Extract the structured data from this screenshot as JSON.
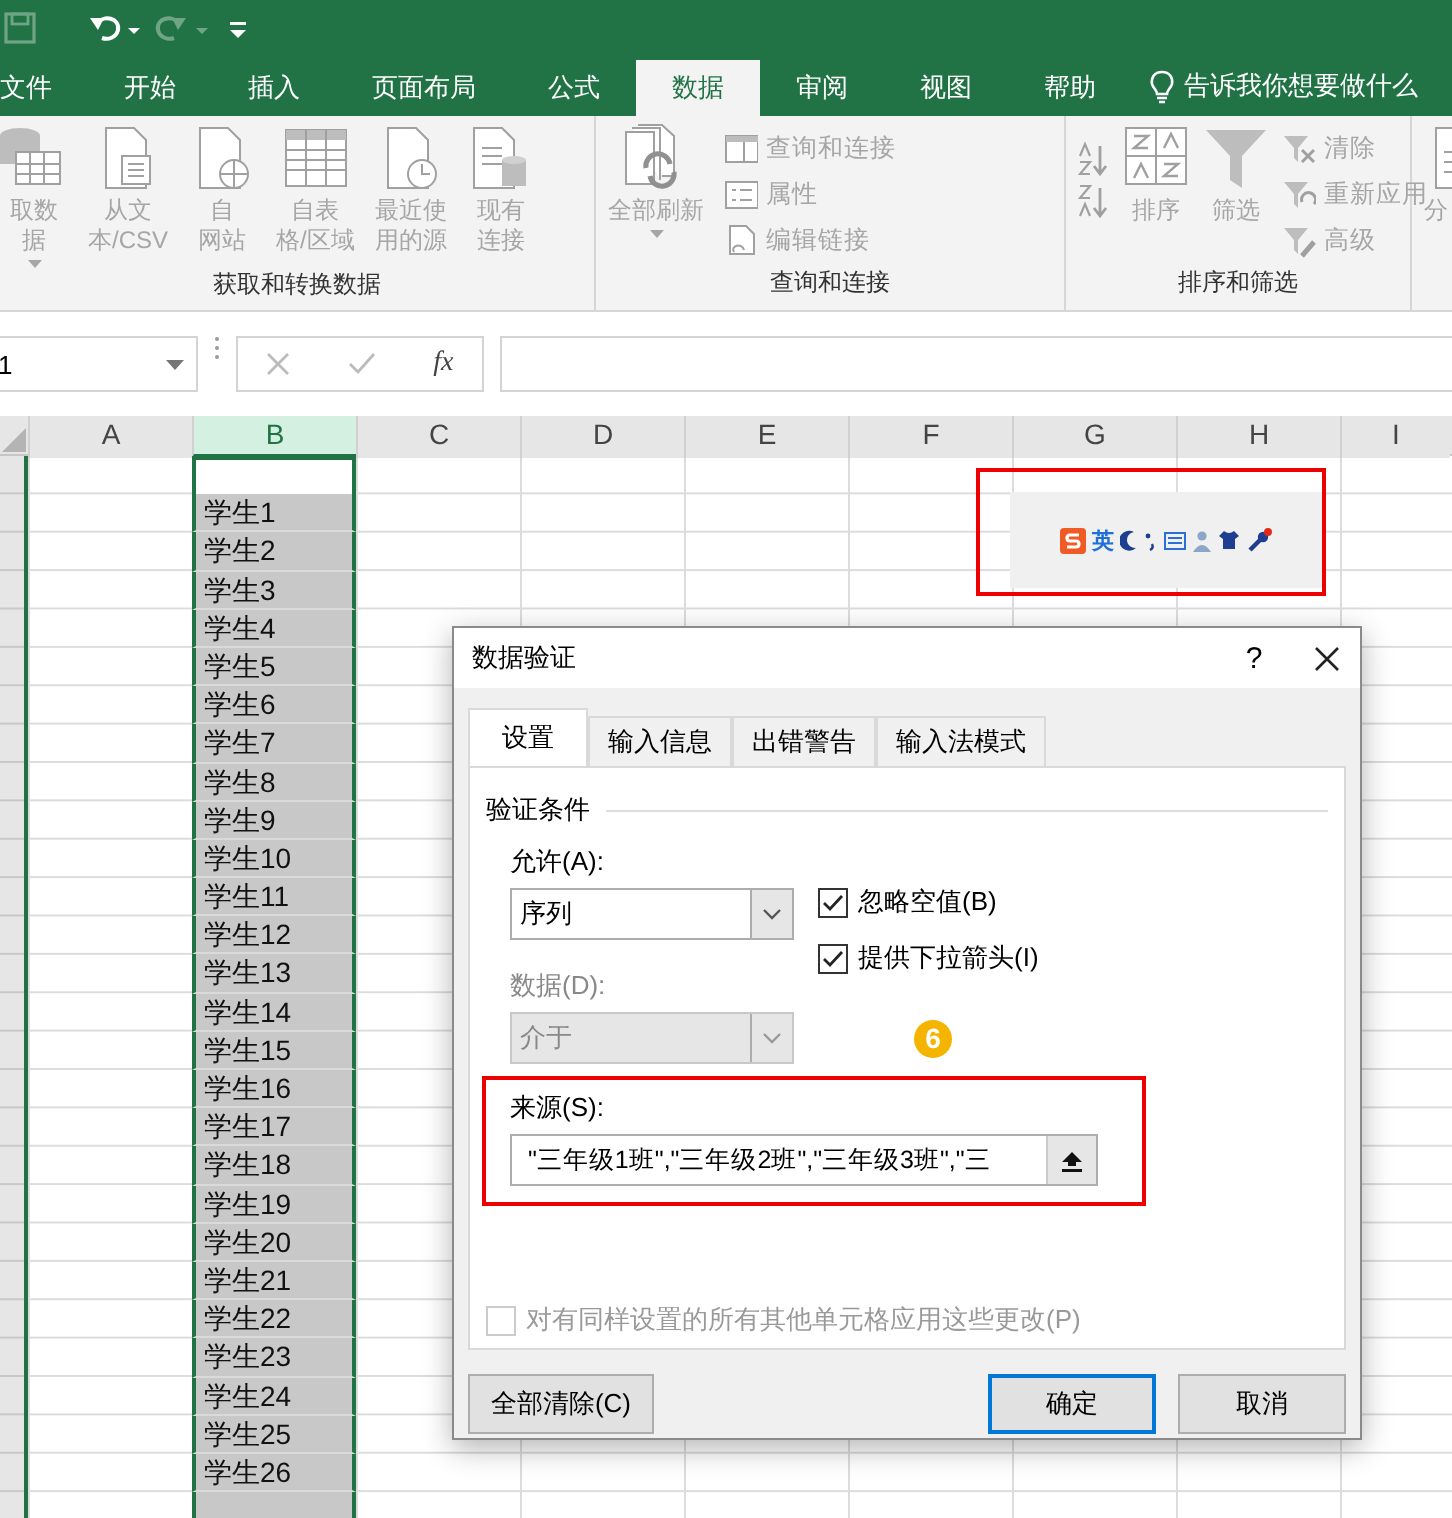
{
  "ribbon_tabs": [
    {
      "label": "文件",
      "selected": false
    },
    {
      "label": "开始",
      "selected": false
    },
    {
      "label": "插入",
      "selected": false
    },
    {
      "label": "页面布局",
      "selected": false
    },
    {
      "label": "公式",
      "selected": false
    },
    {
      "label": "数据",
      "selected": true
    },
    {
      "label": "审阅",
      "selected": false
    },
    {
      "label": "视图",
      "selected": false
    },
    {
      "label": "帮助",
      "selected": false
    }
  ],
  "tell_me": "告诉我你想要做什么",
  "ribbon_groups": [
    {
      "label": "获取和转换数据",
      "buttons": [
        {
          "lines": [
            "取数",
            "据"
          ],
          "dropdown": true,
          "disabled": true
        },
        {
          "lines": [
            "从文",
            "本/CSV"
          ],
          "dropdown": false,
          "disabled": true
        },
        {
          "lines": [
            "自",
            "网站"
          ],
          "dropdown": false,
          "disabled": true
        },
        {
          "lines": [
            "自表",
            "格/区域"
          ],
          "dropdown": false,
          "disabled": true
        },
        {
          "lines": [
            "最近使",
            "用的源"
          ],
          "dropdown": false,
          "disabled": true
        },
        {
          "lines": [
            "现有",
            "连接"
          ],
          "dropdown": false,
          "disabled": true
        }
      ]
    },
    {
      "label": "查询和连接",
      "buttons": [
        {
          "lines": [
            "全部刷新"
          ],
          "dropdown": true,
          "disabled": true
        }
      ],
      "small_buttons": [
        {
          "label": "查询和连接",
          "disabled": true
        },
        {
          "label": "属性",
          "disabled": true
        },
        {
          "label": "编辑链接",
          "disabled": true
        }
      ]
    },
    {
      "label": "排序和筛选",
      "buttons": [
        {
          "lines": [
            "排序"
          ],
          "dropdown": false,
          "disabled": true
        },
        {
          "lines": [
            "筛选"
          ],
          "dropdown": false,
          "disabled": true
        }
      ],
      "small_buttons": [
        {
          "label": "清除",
          "disabled": true
        },
        {
          "label": "重新应用",
          "disabled": true
        },
        {
          "label": "高级",
          "disabled": true
        }
      ]
    },
    {
      "buttons": [
        {
          "lines": [
            "分"
          ],
          "dropdown": false,
          "disabled": true
        }
      ]
    }
  ],
  "formula_bar": {
    "name_box": "1",
    "fx": "fx"
  },
  "sheet": {
    "columns": [
      {
        "label": "A",
        "selected": false
      },
      {
        "label": "B",
        "selected": true
      },
      {
        "label": "C",
        "selected": false
      },
      {
        "label": "D",
        "selected": false
      },
      {
        "label": "E",
        "selected": false
      },
      {
        "label": "F",
        "selected": false
      },
      {
        "label": "G",
        "selected": false
      },
      {
        "label": "H",
        "selected": false
      },
      {
        "label": "I",
        "selected": false
      }
    ],
    "selected_cells": [
      "学生1",
      "学生2",
      "学生3",
      "学生4",
      "学生5",
      "学生6",
      "学生7",
      "学生8",
      "学生9",
      "学生10",
      "学生11",
      "学生12",
      "学生13",
      "学生14",
      "学生15",
      "学生16",
      "学生17",
      "学生18",
      "学生19",
      "学生20",
      "学生21",
      "学生22",
      "学生23",
      "学生24",
      "学生25",
      "学生26"
    ]
  },
  "ime_toolbar": {
    "mode": "英"
  },
  "dialog": {
    "title": "数据验证",
    "help": "?",
    "tabs": [
      {
        "label": "设置",
        "selected": true
      },
      {
        "label": "输入信息",
        "selected": false
      },
      {
        "label": "出错警告",
        "selected": false
      },
      {
        "label": "输入法模式",
        "selected": false
      }
    ],
    "section": "验证条件",
    "allow": {
      "label": "允许(A):",
      "value": "序列",
      "disabled": false
    },
    "data": {
      "label": "数据(D):",
      "value": "介于",
      "disabled": true
    },
    "checkboxes": [
      {
        "label": "忽略空值(B)",
        "checked": true,
        "disabled": false
      },
      {
        "label": "提供下拉箭头(I)",
        "checked": true,
        "disabled": false
      }
    ],
    "source": {
      "label": "来源(S):",
      "value": "\"三年级1班\",\"三年级2班\",\"三年级3班\",\"三"
    },
    "apply_all": {
      "label": "对有同样设置的所有其他单元格应用这些更改(P)",
      "checked": false,
      "disabled": true
    },
    "buttons": [
      {
        "label": "全部清除(C)",
        "default": false
      },
      {
        "label": "确定",
        "default": true
      },
      {
        "label": "取消",
        "default": false
      }
    ],
    "step_badge": "6"
  }
}
